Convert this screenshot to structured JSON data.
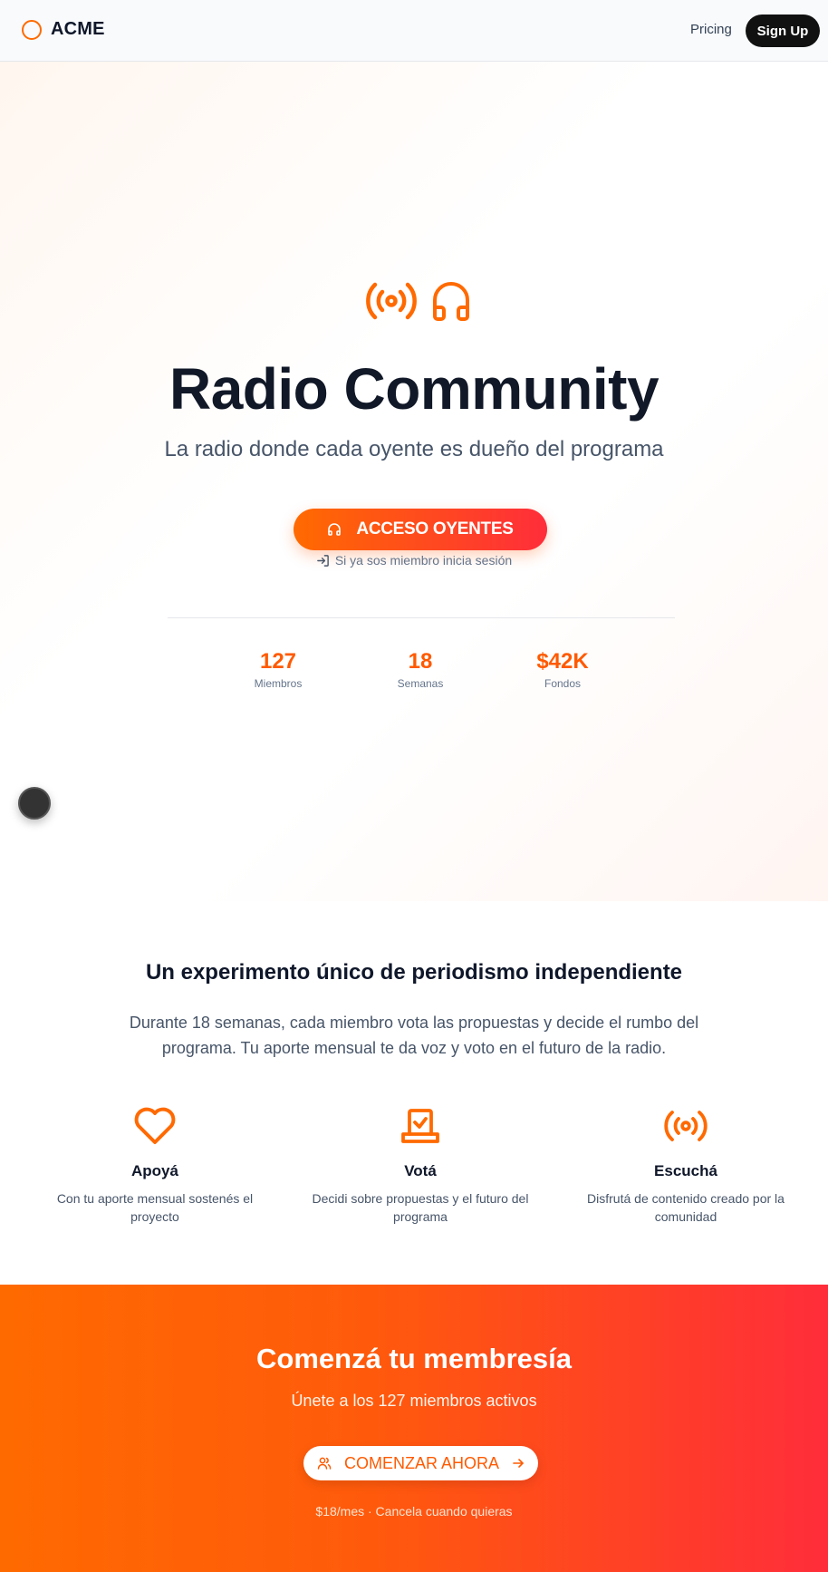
{
  "nav": {
    "brand": "ACME",
    "pricing": "Pricing",
    "signup": "Sign Up"
  },
  "hero": {
    "title": "Radio Community",
    "subtitle": "La radio donde cada oyente es dueño del programa",
    "cta": "ACCESO OYENTES",
    "login_hint": "Si ya sos miembro inicia sesión",
    "stats": [
      {
        "value": "127",
        "label": "Miembros"
      },
      {
        "value": "18",
        "label": "Semanas"
      },
      {
        "value": "$42K",
        "label": "Fondos"
      }
    ]
  },
  "about": {
    "title": "Un experimento único de periodismo independiente",
    "text": "Durante 18 semanas, cada miembro vota las propuestas y decide el rumbo del programa. Tu aporte mensual te da voz y voto en el futuro de la radio.",
    "features": [
      {
        "icon": "heart-icon",
        "title": "Apoyá",
        "text": "Con tu aporte mensual sostenés el proyecto"
      },
      {
        "icon": "vote-box-icon",
        "title": "Votá",
        "text": "Decidi sobre propuestas y el futuro del programa"
      },
      {
        "icon": "broadcast-icon",
        "title": "Escuchá",
        "text": "Disfrutá de contenido creado por la comunidad"
      }
    ]
  },
  "membership": {
    "title": "Comenzá tu membresía",
    "subtitle": "Únete a los 127 miembros activos",
    "cta": "COMENZAR AHORA",
    "note": "$18/mes · Cancela cuando quieras"
  },
  "colors": {
    "accent": "#ff6a00",
    "accent_end": "#ff2d3a",
    "dark": "#111827"
  }
}
